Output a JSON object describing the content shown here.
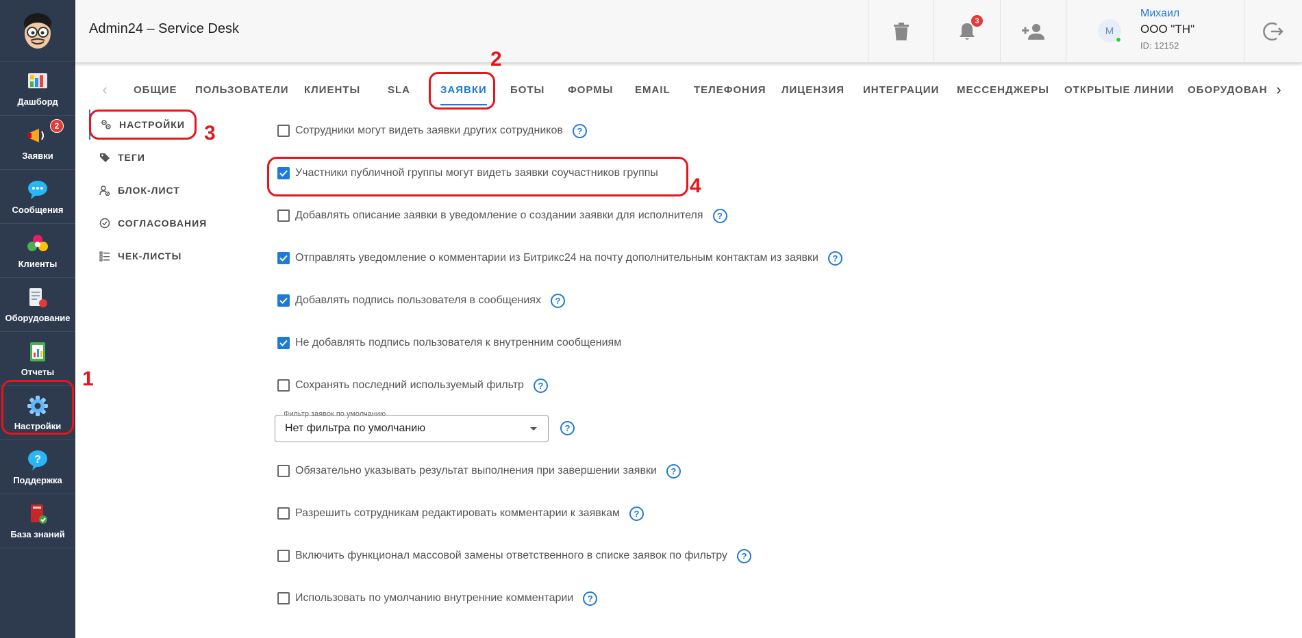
{
  "app": {
    "title": "Admin24 – Service Desk"
  },
  "sidebar": {
    "items": [
      {
        "label": "Дашборд",
        "icon": "dashboard-icon"
      },
      {
        "label": "Заявки",
        "icon": "megaphone-icon",
        "badge": "2"
      },
      {
        "label": "Сообщения",
        "icon": "chat-bubble-icon"
      },
      {
        "label": "Клиенты",
        "icon": "clients-icon"
      },
      {
        "label": "Оборудование",
        "icon": "equipment-icon"
      },
      {
        "label": "Отчеты",
        "icon": "reports-icon"
      },
      {
        "label": "Настройки",
        "icon": "gear-icon"
      },
      {
        "label": "Поддержка",
        "icon": "question-icon"
      },
      {
        "label": "База знаний",
        "icon": "book-icon"
      }
    ]
  },
  "header": {
    "notification_count": "3",
    "user": {
      "avatar_initial": "M",
      "name": "Михаил",
      "org": "ООО \"ТН\"",
      "id": "ID: 12152"
    }
  },
  "tabs": [
    {
      "label": "ОБЩИЕ"
    },
    {
      "label": "ПОЛЬЗОВАТЕЛИ"
    },
    {
      "label": "КЛИЕНТЫ"
    },
    {
      "label": "SLA"
    },
    {
      "label": "ЗАЯВКИ",
      "active": true
    },
    {
      "label": "БОТЫ"
    },
    {
      "label": "ФОРМЫ"
    },
    {
      "label": "EMAIL"
    },
    {
      "label": "ТЕЛЕФОНИЯ"
    },
    {
      "label": "ЛИЦЕНЗИЯ"
    },
    {
      "label": "ИНТЕГРАЦИИ"
    },
    {
      "label": "МЕССЕНДЖЕРЫ"
    },
    {
      "label": "ОТКРЫТЫЕ ЛИНИИ"
    },
    {
      "label": "ОБОРУДОВАН"
    }
  ],
  "subnav": [
    {
      "label": "НАСТРОЙКИ",
      "icon": "gears-icon",
      "active": true
    },
    {
      "label": "ТЕГИ",
      "icon": "tag-icon"
    },
    {
      "label": "БЛОК-ЛИСТ",
      "icon": "user-block-icon"
    },
    {
      "label": "СОГЛАСОВАНИЯ",
      "icon": "check-circle-icon"
    },
    {
      "label": "ЧЕК-ЛИСТЫ",
      "icon": "checklist-icon"
    }
  ],
  "settings": [
    {
      "label": "Сотрудники могут видеть заявки других сотрудников",
      "checked": false,
      "help": true
    },
    {
      "label": "Участники публичной группы могут видеть заявки соучастников группы",
      "checked": true,
      "help": false
    },
    {
      "label": "Добавлять описание заявки в уведомление о создании заявки для исполнителя",
      "checked": false,
      "help": true
    },
    {
      "label": "Отправлять уведомление о комментарии из Битрикс24 на почту дополнительным контактам из заявки",
      "checked": true,
      "help": true
    },
    {
      "label": "Добавлять подпись пользователя в сообщениях",
      "checked": true,
      "help": true
    },
    {
      "label": "Не добавлять подпись пользователя к внутренним сообщениям",
      "checked": true,
      "help": false
    },
    {
      "label": "Сохранять последний используемый фильтр",
      "checked": false,
      "help": true
    },
    {
      "label": "Обязательно указывать результат выполнения при завершении заявки",
      "checked": false,
      "help": true
    },
    {
      "label": "Разрешить сотрудникам редактировать комментарии к заявкам",
      "checked": false,
      "help": true
    },
    {
      "label": "Включить функционал массовой замены ответственного в списке заявок по фильтру",
      "checked": false,
      "help": true
    },
    {
      "label": "Использовать по умолчанию внутренние комментарии",
      "checked": false,
      "help": true
    }
  ],
  "filter": {
    "legend": "Фильтр заявок по умолчанию",
    "value": "Нет фильтра по умолчанию"
  },
  "help_glyph": "?",
  "annotations": [
    "1",
    "2",
    "3",
    "4"
  ],
  "colors": {
    "sidebar": "#2e3b4e",
    "accent": "#1e7ad6",
    "annotation": "#e8141c",
    "badge": "#e53935"
  }
}
